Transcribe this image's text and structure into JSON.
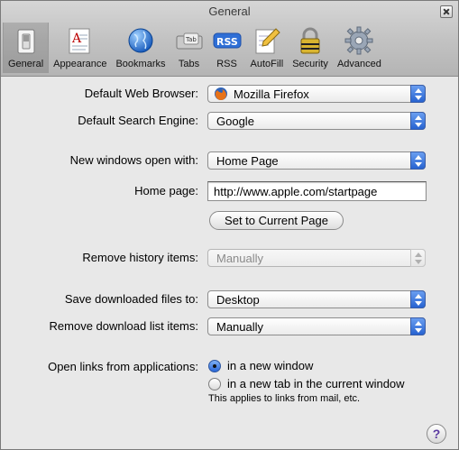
{
  "window": {
    "title": "General"
  },
  "toolbar": {
    "items": [
      {
        "label": "General",
        "icon": "switch-icon",
        "selected": true
      },
      {
        "label": "Appearance",
        "icon": "font-sample-icon"
      },
      {
        "label": "Bookmarks",
        "icon": "globe-icon"
      },
      {
        "label": "Tabs",
        "icon": "tab-icon",
        "badge": "Tab"
      },
      {
        "label": "RSS",
        "icon": "rss-icon",
        "badge": "RSS"
      },
      {
        "label": "AutoFill",
        "icon": "pencil-form-icon"
      },
      {
        "label": "Security",
        "icon": "padlock-icon"
      },
      {
        "label": "Advanced",
        "icon": "gear-icon"
      }
    ]
  },
  "form": {
    "default_browser": {
      "label": "Default Web Browser:",
      "value": "Mozilla Firefox"
    },
    "search_engine": {
      "label": "Default Search Engine:",
      "value": "Google"
    },
    "new_windows": {
      "label": "New windows open with:",
      "value": "Home Page"
    },
    "home_page": {
      "label": "Home page:",
      "value": "http://www.apple.com/startpage"
    },
    "set_current_button": "Set to Current Page",
    "remove_history": {
      "label": "Remove history items:",
      "value": "Manually"
    },
    "save_downloads": {
      "label": "Save downloaded files to:",
      "value": "Desktop"
    },
    "remove_download_list": {
      "label": "Remove download list items:",
      "value": "Manually"
    },
    "open_links": {
      "label": "Open links from applications:",
      "option_new_window": "in a new window",
      "option_new_tab": "in a new tab in the current window",
      "selected": "in a new window",
      "note": "This applies to links from mail, etc."
    }
  },
  "help_button": "?",
  "colors": {
    "accent": "#2a67d8",
    "window_bg": "#e8e8e8"
  }
}
